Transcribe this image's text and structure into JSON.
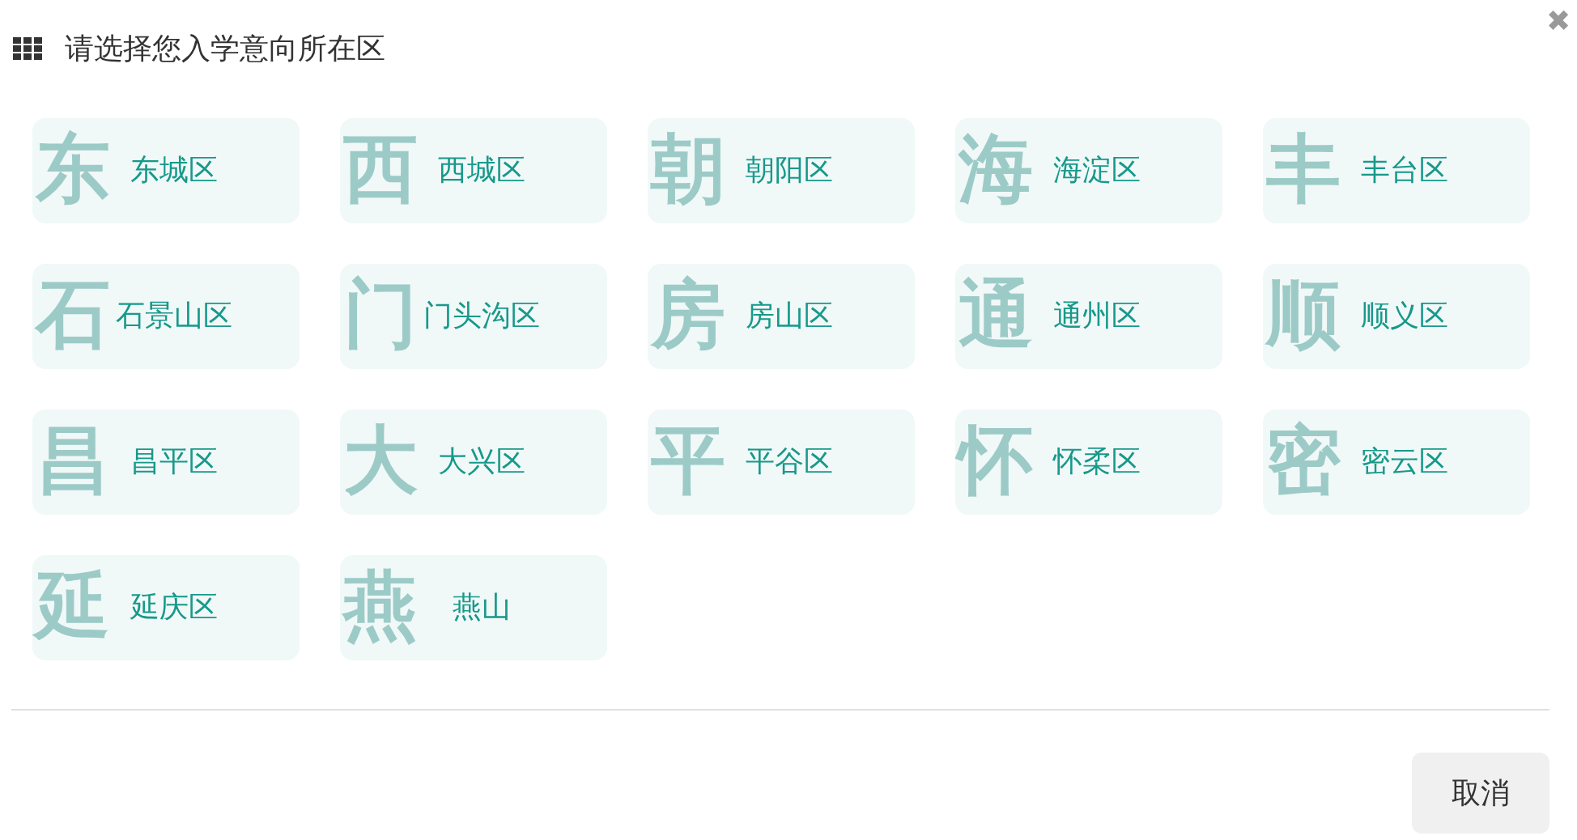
{
  "dialog": {
    "title": "请选择您入学意向所在区",
    "close": "✖"
  },
  "districts": [
    {
      "initial": "东",
      "name": "东城区"
    },
    {
      "initial": "西",
      "name": "西城区"
    },
    {
      "initial": "朝",
      "name": "朝阳区"
    },
    {
      "initial": "海",
      "name": "海淀区"
    },
    {
      "initial": "丰",
      "name": "丰台区"
    },
    {
      "initial": "石",
      "name": "石景山区"
    },
    {
      "initial": "门",
      "name": "门头沟区"
    },
    {
      "initial": "房",
      "name": "房山区"
    },
    {
      "initial": "通",
      "name": "通州区"
    },
    {
      "initial": "顺",
      "name": "顺义区"
    },
    {
      "initial": "昌",
      "name": "昌平区"
    },
    {
      "initial": "大",
      "name": "大兴区"
    },
    {
      "initial": "平",
      "name": "平谷区"
    },
    {
      "initial": "怀",
      "name": "怀柔区"
    },
    {
      "initial": "密",
      "name": "密云区"
    },
    {
      "initial": "延",
      "name": "延庆区"
    },
    {
      "initial": "燕",
      "name": "燕山"
    }
  ],
  "buttons": [
    "取消"
  ]
}
